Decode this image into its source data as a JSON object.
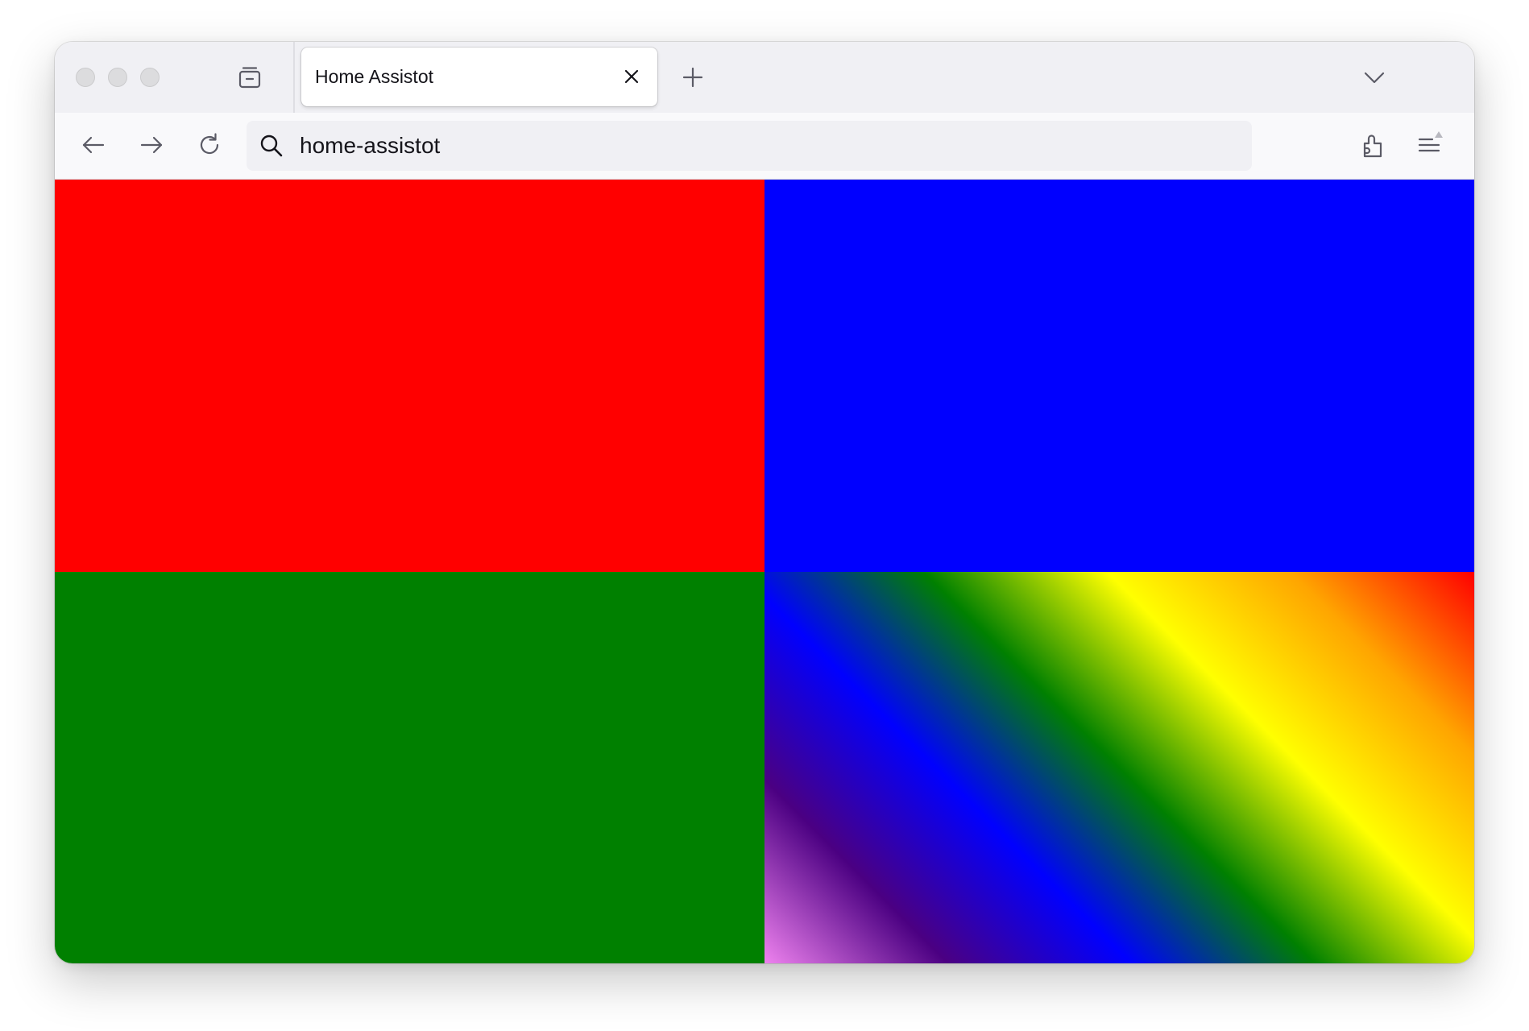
{
  "browser": {
    "tab": {
      "title": "Home Assistot"
    },
    "urlbar": {
      "text": "home-assistot"
    },
    "icons": {
      "tab_overview": "tab-overview-icon",
      "tab_close": "close-icon",
      "new_tab": "plus-icon",
      "tab_list": "chevron-down-icon",
      "back": "arrow-left-icon",
      "forward": "arrow-right-icon",
      "reload": "reload-icon",
      "search": "search-icon",
      "extensions": "puzzle-icon",
      "menu": "hamburger-menu-icon"
    },
    "colors": {
      "chrome_background": "#f0f0f4",
      "toolbar_background": "#f9f9fb",
      "traffic_light_inactive": "#dcdcde",
      "icon_stroke": "#5b5b66"
    }
  },
  "page": {
    "panels": [
      {
        "id": "top-left",
        "color": "#ff0000"
      },
      {
        "id": "top-right",
        "color": "#0000ff"
      },
      {
        "id": "bottom-left",
        "color": "#008000"
      },
      {
        "id": "bottom-right",
        "gradient_angle_deg": 45,
        "gradient_stops": [
          "#ee82ee",
          "#4b0082",
          "#0000ff",
          "#008000",
          "#ffff00",
          "#ffa500",
          "#ff0000"
        ]
      }
    ]
  }
}
